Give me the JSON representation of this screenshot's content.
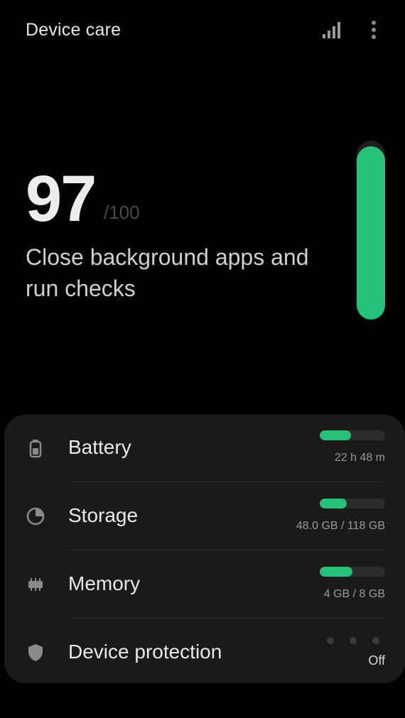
{
  "app_bar": {
    "title": "Device care",
    "icons": [
      "signal-icon",
      "more-vertical-icon"
    ]
  },
  "score": {
    "value": "97",
    "max_label": "/100",
    "message": "Close background apps and run checks",
    "gauge_fraction": 0.97
  },
  "colors": {
    "accent": "#27c27a",
    "background": "#000000",
    "card": "#1a1a1a"
  },
  "items": [
    {
      "label": "Battery",
      "icon": "battery-icon",
      "value": "22 h 48 m",
      "bar_fraction": 0.48
    },
    {
      "label": "Storage",
      "icon": "storage-icon",
      "value": "48.0 GB / 118 GB",
      "bar_fraction": 0.41
    },
    {
      "label": "Memory",
      "icon": "memory-icon",
      "value": "4 GB / 8 GB",
      "bar_fraction": 0.5
    },
    {
      "label": "Device protection",
      "icon": "shield-icon",
      "value": "Off"
    }
  ]
}
